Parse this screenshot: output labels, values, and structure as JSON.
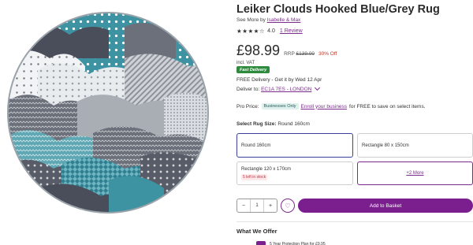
{
  "product": {
    "title": "Leiker Clouds Hooked Blue/Grey Rug",
    "see_more_prefix": "See More by ",
    "see_more_link": "Isabelle & Max",
    "stars": "★★★★☆",
    "rating": "4.0",
    "reviews": "1 Review",
    "image_alt": "Round rug with clouds pattern in blue, grey and white"
  },
  "pricing": {
    "price": "£98.99",
    "rrp_label": "RRP",
    "rrp_value": "£139.00",
    "discount": "30% Off",
    "vat": "incl. VAT",
    "fast_badge": "Fast Delivery"
  },
  "delivery": {
    "free_text": "FREE Delivery - Get it by Wed 12 Apr",
    "deliver_to_label": "Deliver to: ",
    "postcode": "EC1A 7ES - LONDON",
    "chevron_icon": "chevron-down-icon"
  },
  "pro": {
    "label": "Pro Price:",
    "badge": "Businesses Only",
    "enrol_link": "Enroll your business",
    "suffix": " for FREE to save on select items."
  },
  "size": {
    "label": "Select Rug Size:",
    "selected": "Round 160cm",
    "options": [
      {
        "label": "Round 160cm"
      },
      {
        "label": "Rectangle 80 x 150cm"
      },
      {
        "label": "Rectangle 120 x 170cm",
        "stock": "5 left in stock"
      },
      {
        "label": "+2 More"
      }
    ]
  },
  "cart": {
    "minus": "−",
    "qty": "1",
    "plus": "+",
    "wishlist_icon": "heart-icon",
    "add_label": "Add to Basket"
  },
  "offers": {
    "title": "What We Offer",
    "first_item": "5 Year Protection Plan for £9.95"
  },
  "colors": {
    "accent": "#7b1f8f",
    "link": "#7b2c8c",
    "teal": "#3e93a3",
    "dark_grey": "#4a4e5a",
    "fast_green": "#2e8b3e"
  }
}
